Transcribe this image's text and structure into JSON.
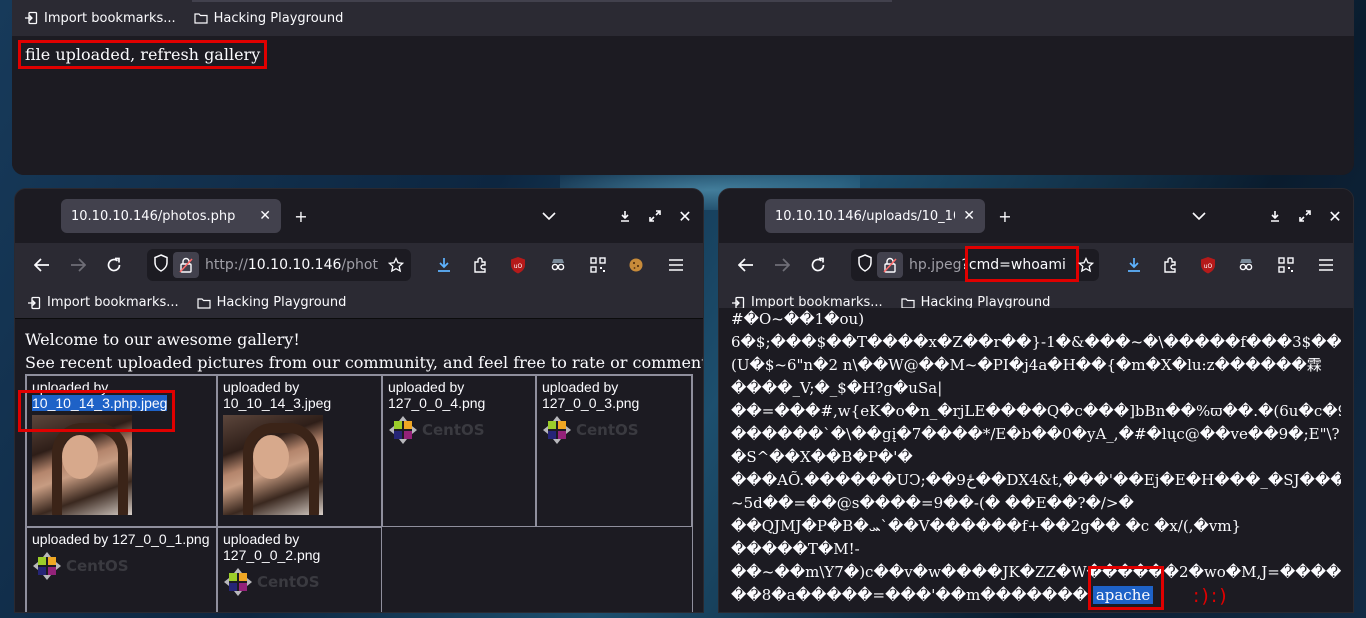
{
  "bookmarks": {
    "import": "Import bookmarks...",
    "folder": "Hacking Playground"
  },
  "top_window": {
    "message": "file uploaded, refresh gallery"
  },
  "left_window": {
    "tab_title": "10.10.10.146/photos.php",
    "url_prefix": "http://",
    "url_host": "10.10.10.146",
    "url_rest": "/phot",
    "page": {
      "line1": "Welcome to our awesome gallery!",
      "line2": "See recent uploaded pictures from our community, and feel free to rate or comment",
      "cells": [
        {
          "caption": "uploaded by",
          "file": "10_10_14_3.php.jpeg"
        },
        {
          "caption": "uploaded by",
          "file": "10_10_14_3.jpeg"
        },
        {
          "caption": "uploaded by",
          "file": "127_0_0_4.png"
        },
        {
          "caption": "uploaded by",
          "file": "127_0_0_3.png"
        },
        {
          "caption": "uploaded by 127_0_0_1.png"
        },
        {
          "caption": "uploaded by",
          "file": "127_0_0_2.png"
        }
      ],
      "centos_label": "CentOS"
    }
  },
  "right_window": {
    "tab_title": "10.10.10.146/uploads/10_10_1",
    "url_visible": "hp.jpeg",
    "url_query": "?cmd=whoami",
    "lines": [
      "#�O~��1�ou)",
      "6�$;���$��T����x�Z��r��}-1�&���~�\\�����f���3$��.",
      "(U�$~6\"n�2 n\\��W@��M~�PI�j4a�H��{�m�X�lu:z������霖",
      "����_V;�_$�H?g�uSa|",
      "��=���#,w{eK�o�n_�rjLE����Q�c���]bBn��%ϖ��.�(6u�c�9",
      "������`�\\��gį�7����*/E�b��0�yA_,�#�lųc@��ve��9�;E\"\\?",
      "�S^��X��B�P�'�",
      "���AÕ.������UϽ;��9ځ��DX4&t,���'��Ej�E�H���_�SJ���",
      "~5d��=��@s����=9��-(� ��E��?�/>�",
      "��QJMJ�P�B�ܚ`��V������f+��2g�� �c �x/(,�vm}",
      "�����T�M!-",
      "��~��m\\Y7�)c��v�w����JK�ZZ�W������2�wo�M,J=������",
      "��8�a�����=���'��m�������"
    ],
    "output": "apache",
    "smiley": ":):)"
  }
}
